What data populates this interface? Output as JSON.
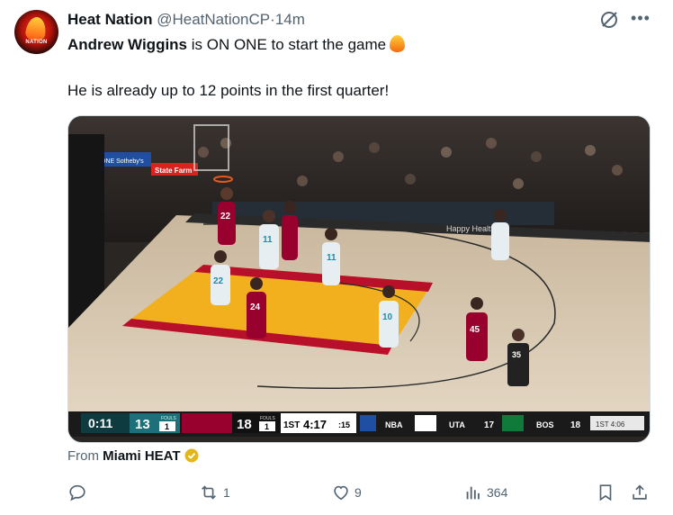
{
  "author": {
    "name": "Heat Nation",
    "handle": "@HeatNationCP",
    "separator": "·",
    "time": "14m",
    "avatar_text": "NATION"
  },
  "tweet": {
    "line1_bold": "Andrew Wiggins",
    "line1_rest": " is ON ONE to start the game",
    "line2": "He is already up to 12 points in the first quarter!"
  },
  "scoreboard": {
    "shot_clock": "0:11",
    "home_score": "13",
    "home_fouls_label": "FOULS",
    "home_fouls": "1",
    "away_score": "18",
    "away_fouls_label": "FOULS",
    "away_fouls": "1",
    "period": "1ST",
    "game_clock": "4:17",
    "shot_remaining": ":15",
    "network": "NBA",
    "other_game_away": "UTA",
    "other_game_away_score": "17",
    "other_game_home": "BOS",
    "other_game_home_score": "18",
    "other_game_status": "1ST 4:06"
  },
  "court_signage": {
    "sign1": "ONE  Sotheby's",
    "sign2": "State Farm",
    "baseline": "Happy Health"
  },
  "jerseys": [
    "22",
    "22",
    "11",
    "11",
    "10",
    "24",
    "45",
    "35"
  ],
  "source": {
    "prefix": "From ",
    "name": "Miami HEAT"
  },
  "actions": {
    "reply": "",
    "retweet": "1",
    "like": "9",
    "views": "364"
  },
  "colors": {
    "accent_blue": "#1d9bf0",
    "badge_gold": "#e2b719",
    "heat_red": "#98002e",
    "hornets_teal": "#1d8cab"
  }
}
